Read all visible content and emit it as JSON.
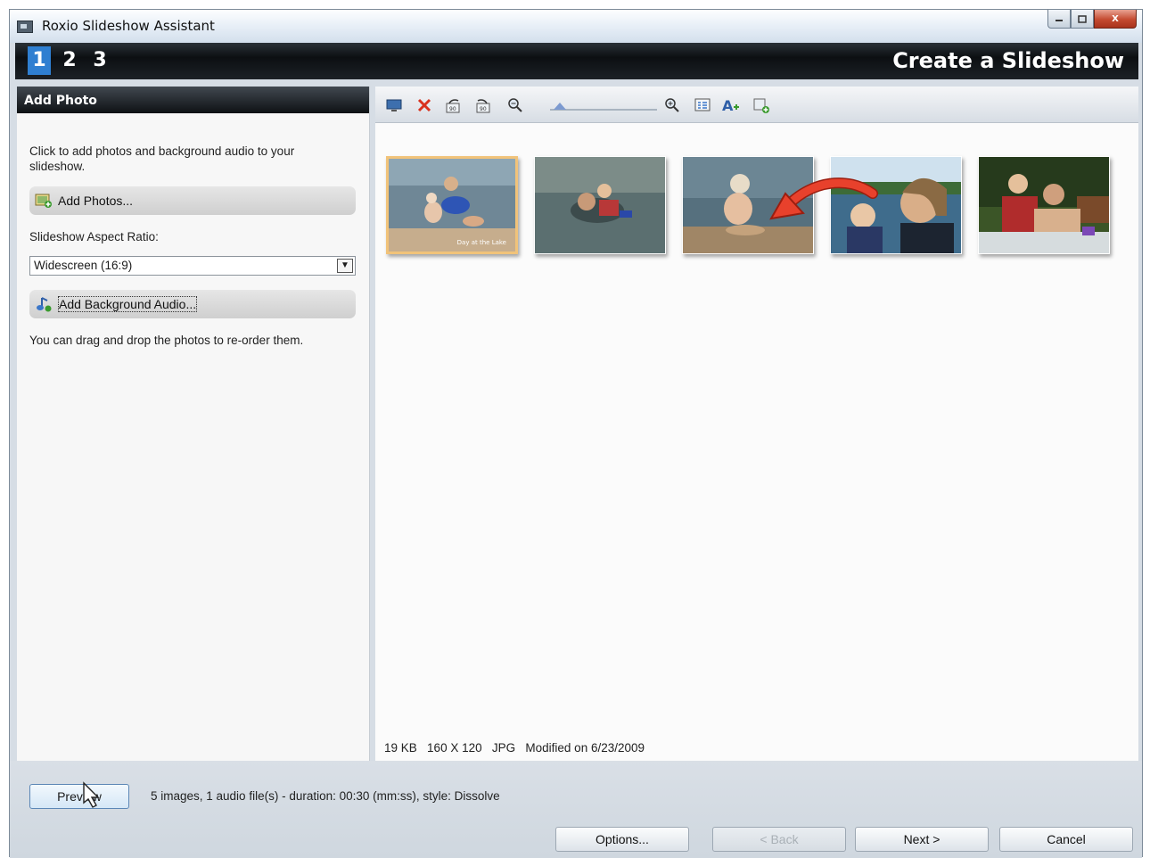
{
  "window": {
    "title": "Roxio Slideshow Assistant",
    "controls": {
      "minimize": "minimize",
      "maximize": "maximize",
      "close": "X"
    }
  },
  "header": {
    "steps": [
      "1",
      "2",
      "3"
    ],
    "active_step": "1",
    "title": "Create a Slideshow"
  },
  "left_panel": {
    "heading": "Add Photo",
    "intro": "Click to add photos and background audio to your slideshow.",
    "add_photos_label": "Add Photos...",
    "aspect_label": "Slideshow Aspect Ratio:",
    "aspect_value": "Widescreen (16:9)",
    "add_audio_label": "Add Background Audio...",
    "drag_hint": "You can drag and drop the photos to re-order them."
  },
  "toolbar": {
    "icons": [
      "monitor-icon",
      "delete-icon",
      "rotate-left-icon",
      "rotate-right-icon",
      "zoom-out-icon",
      "zoom-slider",
      "zoom-in-icon",
      "grid-view-icon",
      "add-text-icon",
      "add-transition-icon"
    ]
  },
  "photos": [
    {
      "caption": "Day at the Lake",
      "selected": true
    },
    {
      "caption": "",
      "selected": false
    },
    {
      "caption": "",
      "selected": false
    },
    {
      "caption": "",
      "selected": false
    },
    {
      "caption": "",
      "selected": false
    }
  ],
  "file_info": {
    "size": "19 KB",
    "dimensions": "160 X 120",
    "type": "JPG",
    "modified": "Modified on 6/23/2009"
  },
  "footer": {
    "preview_label": "Preview",
    "status": "5 images,  1 audio file(s) - duration: 00:30 (mm:ss), style: Dissolve",
    "options_label": "Options...",
    "back_label": "< Back",
    "next_label": "Next >",
    "cancel_label": "Cancel"
  },
  "colors": {
    "accent": "#2f7fd1",
    "selection": "#f1c37a",
    "arrow": "#e8412c"
  }
}
